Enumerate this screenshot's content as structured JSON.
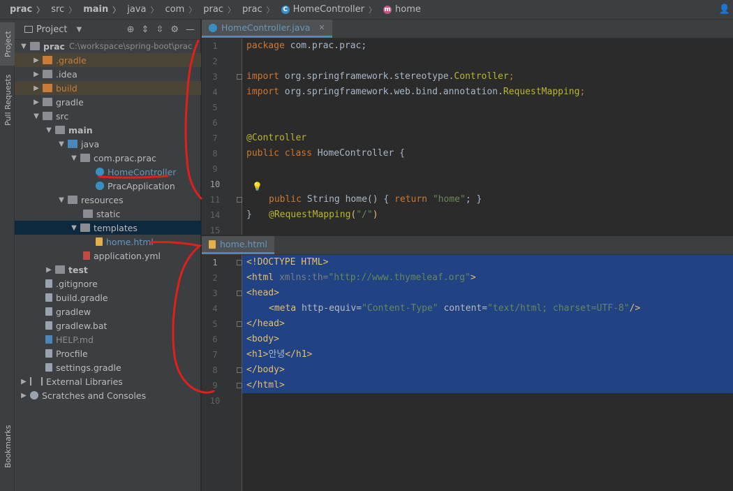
{
  "breadcrumb": {
    "items": [
      "prac",
      "src",
      "main",
      "java",
      "com",
      "prac",
      "prac",
      "HomeController",
      "home"
    ]
  },
  "left_strip": {
    "project_tab": "Project",
    "pull_requests_tab": "Pull Requests",
    "bookmarks_tab": "Bookmarks"
  },
  "project_panel": {
    "title": "Project",
    "tree": [
      {
        "label": "prac",
        "path": "C:\\workspace\\spring-boot\\prac"
      },
      {
        "label": ".gradle"
      },
      {
        "label": ".idea"
      },
      {
        "label": "build"
      },
      {
        "label": "gradle"
      },
      {
        "label": "src"
      },
      {
        "label": "main"
      },
      {
        "label": "java"
      },
      {
        "label": "com.prac.prac"
      },
      {
        "label": "HomeController"
      },
      {
        "label": "PracApplication"
      },
      {
        "label": "resources"
      },
      {
        "label": "static"
      },
      {
        "label": "templates"
      },
      {
        "label": "home.html"
      },
      {
        "label": "application.yml"
      },
      {
        "label": "test"
      },
      {
        "label": ".gitignore"
      },
      {
        "label": "build.gradle"
      },
      {
        "label": "gradlew"
      },
      {
        "label": "gradlew.bat"
      },
      {
        "label": "HELP.md"
      },
      {
        "label": "Procfile"
      },
      {
        "label": "settings.gradle"
      },
      {
        "label": "External Libraries"
      },
      {
        "label": "Scratches and Consoles"
      }
    ]
  },
  "editor_top": {
    "tab": "HomeController.java",
    "lines": [
      "1",
      "2",
      "3",
      "4",
      "5",
      "6",
      "7",
      "8",
      "9",
      "10",
      "11",
      "14",
      "15"
    ],
    "code": {
      "l1_kw": "package",
      "l1_rest": " com.prac.prac;",
      "l3_kw": "import",
      "l3_pkg": " org.springframework.stereotype.",
      "l3_cls": "Controller",
      "l3_end": ";",
      "l4_kw": "import",
      "l4_pkg": " org.springframework.web.bind.annotation.",
      "l4_cls": "RequestMapping",
      "l4_end": ";",
      "l7": "@Controller",
      "l8_kw": "public class",
      "l8_rest": " HomeController {",
      "l10_ann": "@RequestMapping",
      "l10_open": "(",
      "l10_str": "\"/\"",
      "l10_close": ")",
      "l11_kw": "public",
      "l11_type": " String ",
      "l11_m": "home() { ",
      "l11_ret": "return",
      "l11_str": " \"home\"",
      "l11_end": "; }",
      "l14": "}"
    }
  },
  "editor_bottom": {
    "tab": "home.html",
    "lines": [
      "1",
      "2",
      "3",
      "4",
      "5",
      "6",
      "7",
      "8",
      "9",
      "10"
    ],
    "code": {
      "l1": "<!DOCTYPE HTML>",
      "l2_tag": "<html",
      "l2_attr": " xmlns:th=",
      "l2_val": "\"http://www.thymeleaf.org\"",
      "l2_end": ">",
      "l3": "<head>",
      "l4_tag": "<meta",
      "l4_a1": " http-equiv=",
      "l4_v1": "\"Content-Type\"",
      "l4_a2": " content=",
      "l4_v2": "\"text/html; charset=UTF-8\"",
      "l4_end": "/>",
      "l5": "</head>",
      "l6": "<body>",
      "l7_open": "<h1>",
      "l7_text": "안녕",
      "l7_close": "</h1>",
      "l8": "</body>",
      "l9": "</html>"
    }
  },
  "colors": {
    "keyword": "#cc7832",
    "string": "#6a8759",
    "annotation": "#bbb529",
    "tag": "#e8bf6a",
    "selection": "#214283",
    "annotation_pen": "#e0201a"
  }
}
